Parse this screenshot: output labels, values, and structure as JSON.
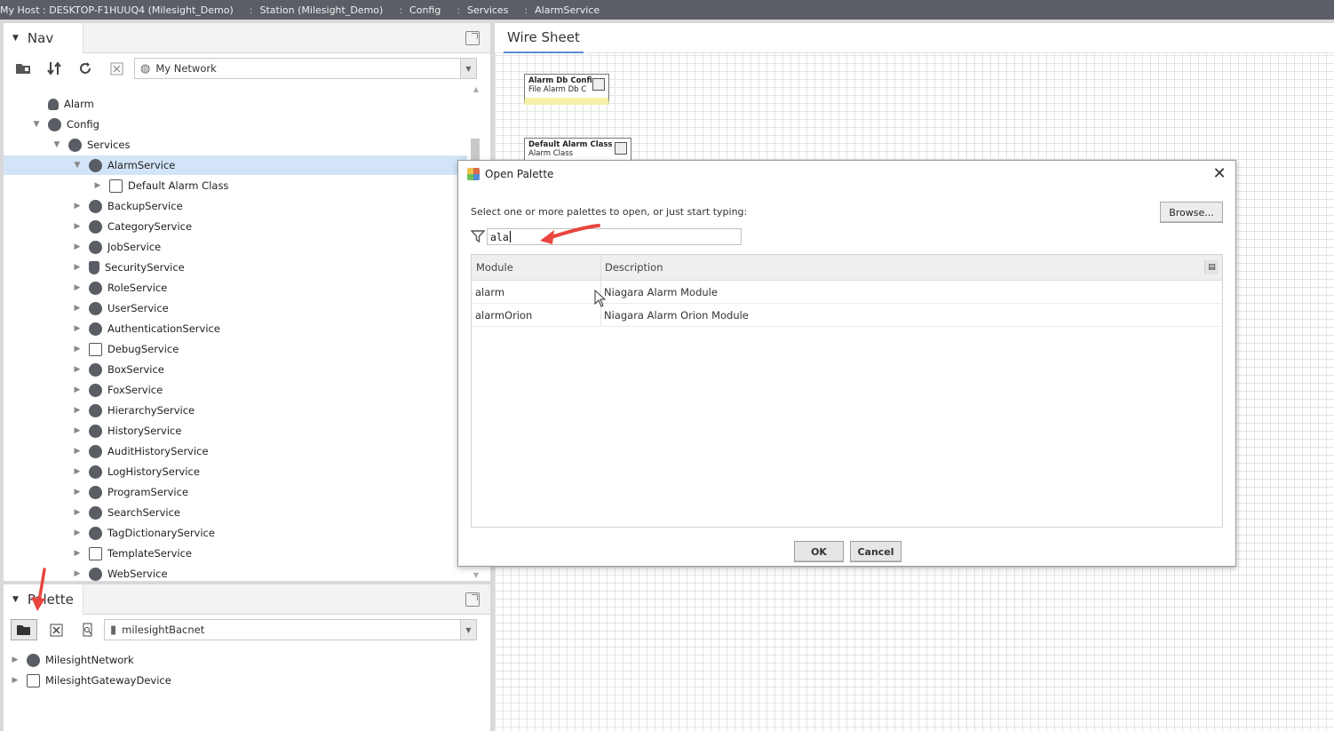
{
  "breadcrumb": [
    "My Host : DESKTOP-F1HUUQ4 (Milesight_Demo)",
    "Station (Milesight_Demo)",
    "Config",
    "Services",
    "AlarmService"
  ],
  "breadcrumb_separator": ":",
  "nav": {
    "title": "Nav",
    "combo_value": "My Network",
    "tree": [
      {
        "label": "Alarm",
        "indent": 1,
        "icon": "bell-icon",
        "expand": "none"
      },
      {
        "label": "Config",
        "indent": 1,
        "icon": "config-icon",
        "expand": "expanded"
      },
      {
        "label": "Services",
        "indent": 2,
        "icon": "services-icon",
        "expand": "expanded"
      },
      {
        "label": "AlarmService",
        "indent": 3,
        "icon": "alarm-service-icon",
        "expand": "expanded",
        "selected": true
      },
      {
        "label": "Default Alarm Class",
        "indent": 4,
        "icon": "alarm-class-icon",
        "expand": "collapsed"
      },
      {
        "label": "BackupService",
        "indent": 3,
        "icon": "service-icon",
        "expand": "collapsed"
      },
      {
        "label": "CategoryService",
        "indent": 3,
        "icon": "service-icon",
        "expand": "collapsed"
      },
      {
        "label": "JobService",
        "indent": 3,
        "icon": "service-icon",
        "expand": "collapsed"
      },
      {
        "label": "SecurityService",
        "indent": 3,
        "icon": "shield-icon",
        "expand": "collapsed"
      },
      {
        "label": "RoleService",
        "indent": 3,
        "icon": "service-icon",
        "expand": "collapsed"
      },
      {
        "label": "UserService",
        "indent": 3,
        "icon": "service-icon",
        "expand": "collapsed"
      },
      {
        "label": "AuthenticationService",
        "indent": 3,
        "icon": "service-icon",
        "expand": "collapsed"
      },
      {
        "label": "DebugService",
        "indent": 3,
        "icon": "debug-icon",
        "expand": "collapsed"
      },
      {
        "label": "BoxService",
        "indent": 3,
        "icon": "service-icon",
        "expand": "collapsed"
      },
      {
        "label": "FoxService",
        "indent": 3,
        "icon": "fox-icon",
        "expand": "collapsed"
      },
      {
        "label": "HierarchyService",
        "indent": 3,
        "icon": "service-icon",
        "expand": "collapsed"
      },
      {
        "label": "HistoryService",
        "indent": 3,
        "icon": "service-icon",
        "expand": "collapsed"
      },
      {
        "label": "AuditHistoryService",
        "indent": 3,
        "icon": "service-icon",
        "expand": "collapsed"
      },
      {
        "label": "LogHistoryService",
        "indent": 3,
        "icon": "service-icon",
        "expand": "collapsed"
      },
      {
        "label": "ProgramService",
        "indent": 3,
        "icon": "service-icon",
        "expand": "collapsed"
      },
      {
        "label": "SearchService",
        "indent": 3,
        "icon": "service-icon",
        "expand": "collapsed"
      },
      {
        "label": "TagDictionaryService",
        "indent": 3,
        "icon": "service-icon",
        "expand": "collapsed"
      },
      {
        "label": "TemplateService",
        "indent": 3,
        "icon": "template-icon",
        "expand": "collapsed"
      },
      {
        "label": "WebService",
        "indent": 3,
        "icon": "service-icon",
        "expand": "collapsed"
      }
    ]
  },
  "palette": {
    "title": "Palette",
    "combo_value": "milesightBacnet",
    "tree": [
      {
        "label": "MilesightNetwork",
        "icon": "network-icon"
      },
      {
        "label": "MilesightGatewayDevice",
        "icon": "device-icon"
      }
    ]
  },
  "wiresheet": {
    "title": "Wire Sheet",
    "nodes": [
      {
        "title": "Alarm Db Config",
        "subtitle": "File Alarm Db C"
      },
      {
        "title": "Default Alarm Class",
        "subtitle": "Alarm Class"
      }
    ]
  },
  "dialog": {
    "title": "Open Palette",
    "prompt": "Select one or more palettes to open, or just start typing:",
    "browse_label": "Browse...",
    "filter_value": "ala",
    "columns": [
      "Module",
      "Description"
    ],
    "rows": [
      {
        "module": "alarm",
        "description": "Niagara Alarm Module"
      },
      {
        "module": "alarmOrion",
        "description": "Niagara Alarm Orion Module"
      }
    ],
    "ok_label": "OK",
    "cancel_label": "Cancel"
  },
  "colors": {
    "breadcrumb_bg": "#5b5e66",
    "selection": "#d3e4f8",
    "annotation_arrow": "#e8453c"
  }
}
